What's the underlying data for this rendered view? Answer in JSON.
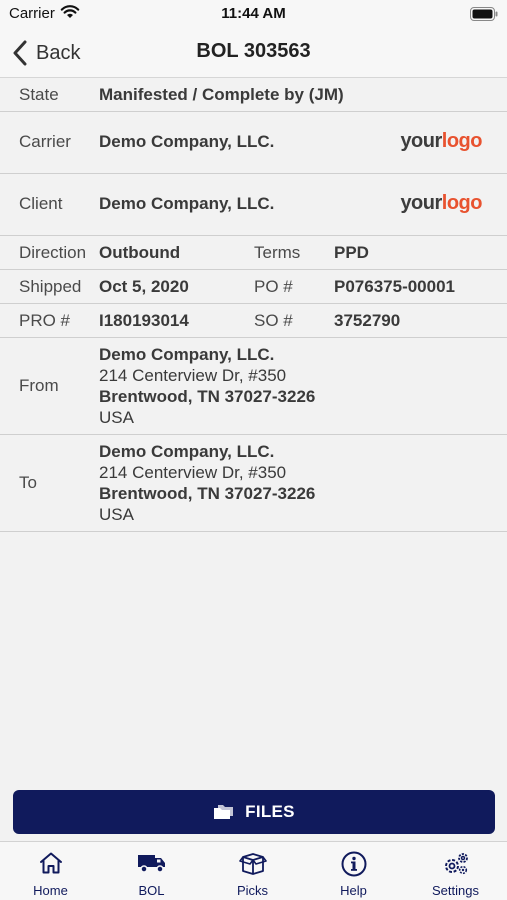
{
  "status_bar": {
    "carrier": "Carrier",
    "time": "11:44 AM"
  },
  "nav": {
    "back_label": "Back",
    "title": "BOL 303563"
  },
  "details": {
    "state": {
      "label": "State",
      "value": "Manifested / Complete by (JM)"
    },
    "carrier": {
      "label": "Carrier",
      "value": "Demo Company, LLC.",
      "logo_your": "your",
      "logo_logo": "logo"
    },
    "client": {
      "label": "Client",
      "value": "Demo Company, LLC.",
      "logo_your": "your",
      "logo_logo": "logo"
    },
    "direction": {
      "label": "Direction",
      "value": "Outbound",
      "label2": "Terms",
      "value2": "PPD"
    },
    "shipped": {
      "label": "Shipped",
      "value": "Oct 5, 2020",
      "label2": "PO #",
      "value2": "P076375-00001"
    },
    "pro": {
      "label": "PRO #",
      "value": "I180193014",
      "label2": "SO #",
      "value2": "3752790"
    },
    "from": {
      "label": "From",
      "name": "Demo Company, LLC.",
      "street": "214 Centerview Dr, #350",
      "city": "Brentwood, TN 37027-3226",
      "country": "USA"
    },
    "to": {
      "label": "To",
      "name": "Demo Company, LLC.",
      "street": "214 Centerview Dr, #350",
      "city": "Brentwood, TN 37027-3226",
      "country": "USA"
    }
  },
  "files_button": {
    "label": "FILES",
    "icon": "folder-icon"
  },
  "tabs": [
    {
      "label": "Home",
      "icon": "home-icon"
    },
    {
      "label": "BOL",
      "icon": "truck-icon"
    },
    {
      "label": "Picks",
      "icon": "box-icon"
    },
    {
      "label": "Help",
      "icon": "info-icon"
    },
    {
      "label": "Settings",
      "icon": "gears-icon"
    }
  ],
  "colors": {
    "primary": "#101a5c",
    "logo_accent": "#e8522f",
    "background": "#f2f2f2"
  }
}
